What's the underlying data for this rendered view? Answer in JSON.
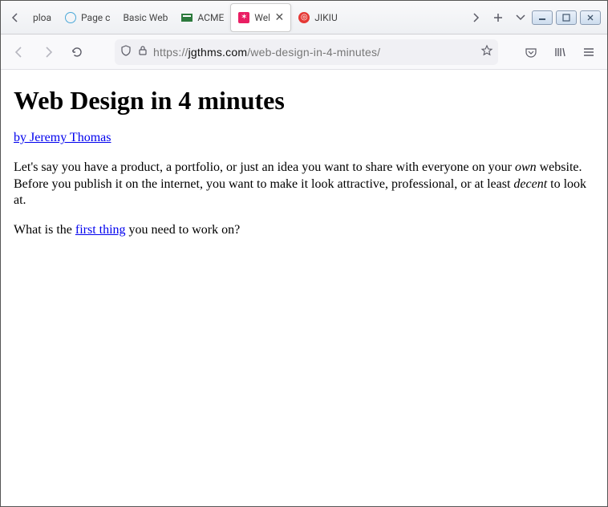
{
  "window": {
    "minimize": "—",
    "maximize": "☐",
    "close": "✕"
  },
  "tabs": {
    "scroll_left": "‹",
    "scroll_right": "›",
    "new_tab": "+",
    "all_tabs": "⌄",
    "items": [
      {
        "label": "ploa"
      },
      {
        "label": "Page c"
      },
      {
        "label": "Basic Web"
      },
      {
        "label": "ACME"
      },
      {
        "label": "Wel"
      },
      {
        "label": "JIKIU"
      }
    ]
  },
  "toolbar": {
    "back": "←",
    "forward": "→",
    "reload": "↻",
    "shield": "◯",
    "lock": "🔒",
    "star": "☆",
    "pocket": "⌄",
    "library": "|||\\",
    "menu": "≡"
  },
  "url": {
    "prefix": "https://",
    "domain": "jgthms.com",
    "path": "/web-design-in-4-minutes/"
  },
  "page": {
    "title": "Web Design in 4 minutes",
    "author_link": "by Jeremy Thomas",
    "p1_a": "Let's say you have a product, a portfolio, or just an idea you want to share with everyone on your ",
    "p1_em1": "own",
    "p1_b": " website. Before you publish it on the internet, you want to make it look attractive, professional, or at least ",
    "p1_em2": "decent",
    "p1_c": " to look at.",
    "p2_a": "What is the ",
    "p2_link": "first thing",
    "p2_b": " you need to work on?"
  }
}
